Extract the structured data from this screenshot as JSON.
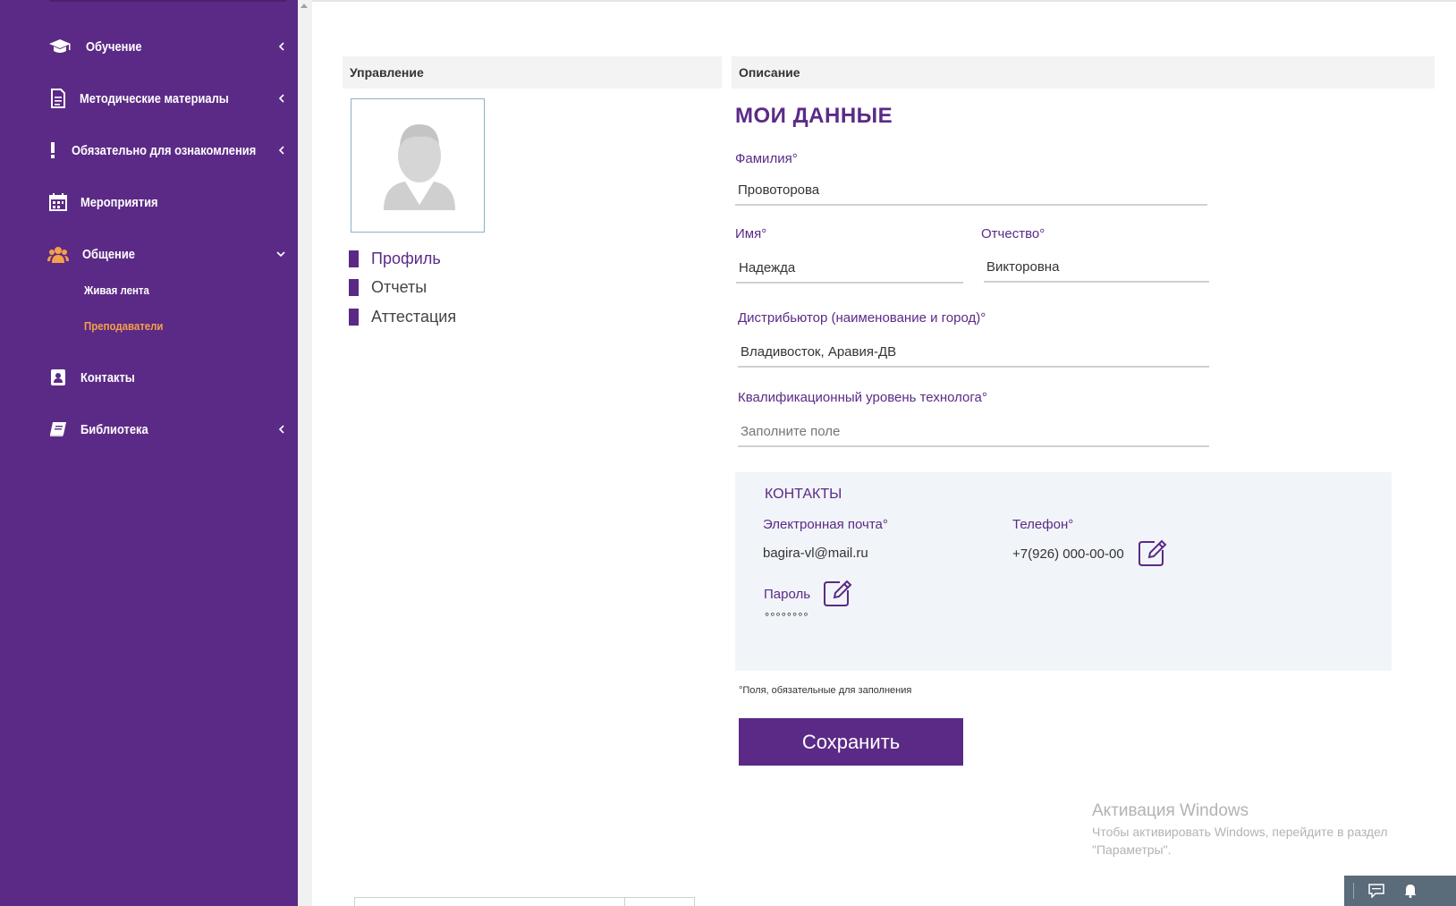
{
  "sidebar": {
    "items": [
      {
        "label": "Обучение",
        "icon": "graduation-cap-icon"
      },
      {
        "label": "Методические материалы",
        "icon": "document-icon"
      },
      {
        "label": "Обязательно для ознакомления",
        "icon": "exclamation-icon"
      },
      {
        "label": "Мероприятия",
        "icon": "calendar-icon"
      },
      {
        "label": "Общение",
        "icon": "users-icon",
        "expanded": true,
        "children": [
          {
            "label": "Живая лента"
          },
          {
            "label": "Преподаватели",
            "active": true
          }
        ]
      },
      {
        "label": "Контакты",
        "icon": "contact-card-icon"
      },
      {
        "label": "Библиотека",
        "icon": "book-icon"
      }
    ],
    "colors": {
      "background": "#5b2a86",
      "active_sub": "#f5a04a",
      "text": "#ffffff"
    }
  },
  "left_panel": {
    "header": "Управление",
    "menu": [
      {
        "label": "Профиль",
        "active": true
      },
      {
        "label": "Отчеты"
      },
      {
        "label": "Аттестация"
      }
    ]
  },
  "right_panel": {
    "header": "Описание",
    "title": "МОИ ДАННЫЕ",
    "fields": {
      "last_name": {
        "label": "Фамилия°",
        "value": "Провоторова"
      },
      "first_name": {
        "label": "Имя°",
        "value": "Надежда"
      },
      "patronymic": {
        "label": "Отчество°",
        "value": "Викторовна"
      },
      "distributor": {
        "label": "Дистрибьютор (наименование и город)°",
        "value": "Владивосток, Аравия-ДВ"
      },
      "qualification": {
        "label": "Квалификационный уровень технолога°",
        "placeholder": "Заполните поле"
      }
    },
    "contacts": {
      "title": "КОНТАКТЫ",
      "email_label": "Электронная почта°",
      "email_value": "bagira-vl@mail.ru",
      "phone_label": "Телефон°",
      "phone_value": "+7(926) 000-00-00",
      "password_label": "Пароль",
      "password_value": "°°°°°°°°"
    },
    "required_note": "°Поля, обязательные для заполнения",
    "save_label": "Сохранить",
    "accent_color": "#5b2a86"
  },
  "watermark": {
    "title": "Активация Windows",
    "text": "Чтобы активировать Windows, перейдите в раздел \"Параметры\"."
  },
  "taskbar": {
    "icons": [
      "chat-icon",
      "bell-icon"
    ]
  }
}
